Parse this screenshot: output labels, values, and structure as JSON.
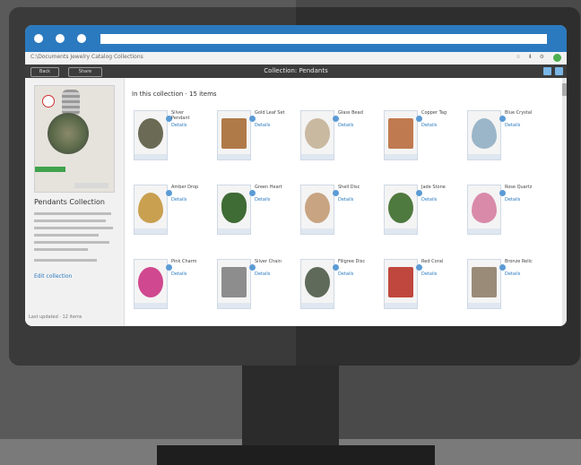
{
  "window": {
    "titlebar_color": "#2b7abf",
    "controls": [
      "dot-1",
      "dot-2",
      "dot-3"
    ]
  },
  "address_bar": {
    "url": "C:\\Documents  Jewelry Catalog  Collections",
    "icons": [
      "star-icon",
      "extensions-icon",
      "download-icon",
      "avatar"
    ]
  },
  "app_bar": {
    "back_label": "Back",
    "share_label": "Share",
    "title": "Collection: Pendants",
    "icons": [
      "edit-icon",
      "grid-icon"
    ]
  },
  "sidebar": {
    "title": "Pendants Collection",
    "link": "Edit collection",
    "footer": "Last updated · 12 items"
  },
  "main": {
    "heading": "In this collection · 15 items",
    "items": [
      {
        "title": "Silver Pendant",
        "link": "Details",
        "art": "#6b6b55",
        "shape": "circle"
      },
      {
        "title": "Gold Leaf Set",
        "link": "Details",
        "art": "#b07a48",
        "shape": "rect"
      },
      {
        "title": "Glass Bead",
        "link": "Details",
        "art": "#c9b9a0",
        "shape": "circle"
      },
      {
        "title": "Copper Tag",
        "link": "Details",
        "art": "#c07a50",
        "shape": "rect"
      },
      {
        "title": "Blue Crystal",
        "link": "Details",
        "art": "#9bb6c9",
        "shape": "drop"
      },
      {
        "title": "Amber Drop",
        "link": "Details",
        "art": "#c9a050",
        "shape": "drop"
      },
      {
        "title": "Green Heart",
        "link": "Details",
        "art": "#3f6b35",
        "shape": "heart"
      },
      {
        "title": "Shell Disc",
        "link": "Details",
        "art": "#c8a482",
        "shape": "circle"
      },
      {
        "title": "Jade Stone",
        "link": "Details",
        "art": "#4f7a3f",
        "shape": "circle"
      },
      {
        "title": "Rose Quartz",
        "link": "Details",
        "art": "#d98aa8",
        "shape": "drop"
      },
      {
        "title": "Pink Charm",
        "link": "Details",
        "art": "#d0488f",
        "shape": "circle"
      },
      {
        "title": "Silver Chain",
        "link": "Details",
        "art": "#8d8d8d",
        "shape": "rect"
      },
      {
        "title": "Filigree Disc",
        "link": "Details",
        "art": "#5f6a5a",
        "shape": "circle"
      },
      {
        "title": "Red Coral",
        "link": "Details",
        "art": "#c0473e",
        "shape": "rect"
      },
      {
        "title": "Bronze Relic",
        "link": "Details",
        "art": "#9a8a78",
        "shape": "rect"
      }
    ]
  }
}
